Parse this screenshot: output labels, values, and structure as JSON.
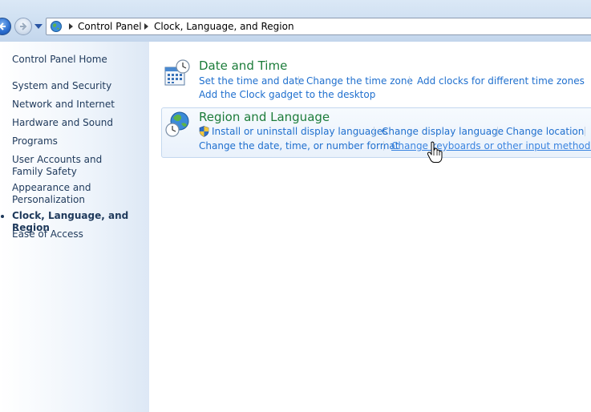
{
  "addressbar": {
    "breadcrumbs": [
      "Control Panel",
      "Clock, Language, and Region"
    ]
  },
  "sidebar": {
    "home_label": "Control Panel Home",
    "items": [
      {
        "label": "System and Security"
      },
      {
        "label": "Network and Internet"
      },
      {
        "label": "Hardware and Sound"
      },
      {
        "label": "Programs"
      },
      {
        "label": "User Accounts and Family Safety"
      },
      {
        "label": "Appearance and Personalization"
      },
      {
        "label": "Clock, Language, and Region",
        "active": true
      },
      {
        "label": "Ease of Access"
      }
    ]
  },
  "categories": [
    {
      "title": "Date and Time",
      "icon": "calendar-clock-icon",
      "links": [
        "Set the time and date",
        "Change the time zone",
        "Add clocks for different time zones",
        "Add the Clock gadget to the desktop"
      ]
    },
    {
      "title": "Region and Language",
      "icon": "globe-clock-icon",
      "links": [
        "Install or uninstall display languages",
        "Change display language",
        "Change location",
        "Change the date, time, or number format",
        "Change keyboards or other input methods"
      ]
    }
  ],
  "colors": {
    "category_title": "#1c7c3a",
    "link": "#1f6fce",
    "sidebar_text": "#1e395b"
  }
}
